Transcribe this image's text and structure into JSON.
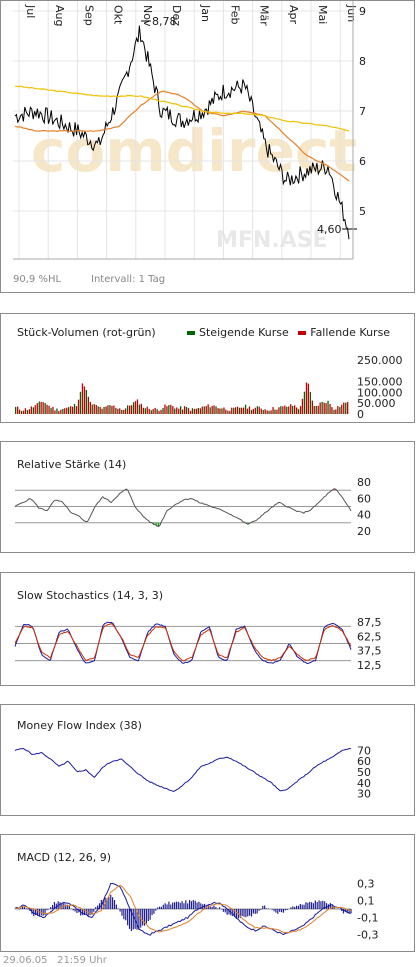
{
  "main": {
    "months": [
      "Jul",
      "Aug",
      "Sep",
      "Okt",
      "Nov",
      "Dez",
      "Jan",
      "Feb",
      "Mär",
      "Apr",
      "Mai",
      "Jun"
    ],
    "yticks": [
      "9",
      "8",
      "7",
      "6",
      "5"
    ],
    "high_label": "8,78",
    "last_label": "4,60",
    "watermark": "comdirect",
    "symbol": "MFN.ASE",
    "hl_label": "90,9 %HL",
    "interval_label": "Intervall: 1 Tag",
    "colors": {
      "price": "#000000",
      "ma38": "#e8802a",
      "ma200": "#f0c000"
    }
  },
  "volume": {
    "title": "Stück-Volumen (rot-grün)",
    "legend_up": "Steigende Kurse",
    "legend_down": "Fallende Kurse",
    "yticks": [
      "250.000",
      "150.000",
      "100.000",
      "50.000",
      "0"
    ],
    "colors": {
      "up": "#006400",
      "down": "#c00000"
    }
  },
  "rsi": {
    "title": "Relative Stärke (14)",
    "yticks": [
      "80",
      "60",
      "40",
      "20"
    ]
  },
  "stoch": {
    "title": "Slow Stochastics (14, 3, 3)",
    "yticks": [
      "87,5",
      "62,5",
      "37,5",
      "12,5"
    ]
  },
  "mfi": {
    "title": "Money Flow Index (38)",
    "yticks": [
      "70",
      "60",
      "50",
      "40",
      "30"
    ]
  },
  "macd": {
    "title": "MACD (12, 26, 9)",
    "yticks": [
      "0,3",
      "0,1",
      "-0,1",
      "-0,3"
    ]
  },
  "footer": {
    "date": "29.06.05",
    "time": "21:59 Uhr"
  },
  "chart_data": [
    {
      "type": "line",
      "title": "",
      "x": [
        "Jul",
        "Aug",
        "Sep",
        "Okt",
        "Nov",
        "Dez",
        "Jan",
        "Feb",
        "Mär",
        "Apr",
        "Mai",
        "Jun"
      ],
      "ylim": [
        4.4,
        9.0
      ],
      "series": [
        {
          "values": [
            6.9,
            7.0,
            6.8,
            6.6,
            6.3,
            7.3,
            8.6,
            7.0,
            6.8,
            7.0,
            7.4,
            7.5,
            6.3,
            5.6,
            5.8,
            5.9,
            4.6
          ]
        },
        {
          "values": [
            6.7,
            6.6,
            6.6,
            6.6,
            6.6,
            6.7,
            7.1,
            7.4,
            7.3,
            7.0,
            6.9,
            7.0,
            6.9,
            6.5,
            6.1,
            5.9,
            5.6
          ]
        },
        {
          "values": [
            7.5,
            7.45,
            7.4,
            7.35,
            7.3,
            7.3,
            7.3,
            7.2,
            7.1,
            7.0,
            6.95,
            6.95,
            6.9,
            6.8,
            6.75,
            6.7,
            6.6
          ]
        }
      ],
      "annotations": [
        "8,78",
        "4,60"
      ]
    },
    {
      "type": "bar",
      "ylim": [
        0,
        250000
      ],
      "series": [
        {
          "values": [
            30000,
            20000,
            25000,
            40000,
            60000,
            35000,
            20000,
            25000,
            30000,
            45000,
            150000,
            50000,
            35000,
            25000,
            40000,
            30000,
            20000,
            45000,
            60000,
            30000,
            25000,
            20000,
            35000,
            40000,
            25000,
            30000,
            20000,
            25000,
            35000,
            40000,
            30000,
            25000,
            20000,
            30000,
            35000,
            25000,
            30000,
            20000,
            25000,
            30000,
            35000,
            40000,
            25000,
            160000,
            30000,
            50000,
            60000,
            25000,
            40000,
            60000
          ]
        }
      ]
    },
    {
      "type": "line",
      "ylim": [
        10,
        85
      ],
      "series": [
        {
          "values": [
            50,
            55,
            60,
            48,
            45,
            58,
            55,
            42,
            38,
            30,
            50,
            62,
            55,
            65,
            72,
            50,
            38,
            30,
            25,
            45,
            52,
            58,
            60,
            55,
            52,
            48,
            45,
            40,
            35,
            28,
            32,
            40,
            48,
            55,
            50,
            45,
            42,
            46,
            55,
            65,
            72,
            60,
            45
          ]
        }
      ]
    },
    {
      "type": "line",
      "ylim": [
        0,
        100
      ],
      "series": [
        {
          "values": [
            45,
            85,
            80,
            30,
            20,
            70,
            75,
            40,
            15,
            20,
            85,
            88,
            60,
            25,
            20,
            70,
            85,
            80,
            30,
            15,
            20,
            70,
            80,
            25,
            20,
            75,
            80,
            40,
            20,
            15,
            20,
            50,
            25,
            15,
            20,
            80,
            85,
            75,
            40
          ]
        },
        {
          "values": [
            50,
            80,
            78,
            35,
            25,
            65,
            72,
            45,
            20,
            25,
            80,
            85,
            62,
            30,
            25,
            65,
            80,
            78,
            35,
            20,
            25,
            65,
            75,
            30,
            25,
            70,
            78,
            45,
            25,
            20,
            25,
            45,
            30,
            20,
            25,
            75,
            82,
            72,
            45
          ]
        }
      ]
    },
    {
      "type": "line",
      "ylim": [
        25,
        75
      ],
      "series": [
        {
          "values": [
            70,
            72,
            66,
            68,
            62,
            55,
            60,
            50,
            52,
            45,
            55,
            60,
            62,
            55,
            48,
            42,
            38,
            35,
            32,
            38,
            45,
            55,
            58,
            62,
            64,
            60,
            55,
            50,
            45,
            40,
            32,
            35,
            42,
            48,
            55,
            60,
            64,
            70,
            72
          ]
        }
      ]
    },
    {
      "type": "line",
      "ylim": [
        -0.35,
        0.35
      ],
      "series": [
        {
          "values": [
            0.0,
            0.05,
            -0.05,
            -0.1,
            0.0,
            0.08,
            0.05,
            -0.05,
            -0.1,
            0.05,
            0.3,
            0.25,
            0.0,
            -0.25,
            -0.3,
            -0.25,
            -0.2,
            -0.15,
            -0.1,
            0.0,
            0.05,
            0.08,
            0.02,
            -0.1,
            -0.2,
            -0.25,
            -0.2,
            -0.25,
            -0.3,
            -0.25,
            -0.2,
            -0.1,
            0.0,
            0.05,
            0.0,
            -0.05
          ]
        },
        {
          "values": [
            0.0,
            0.03,
            0.0,
            -0.06,
            -0.04,
            0.03,
            0.05,
            0.0,
            -0.06,
            -0.02,
            0.2,
            0.28,
            0.15,
            -0.1,
            -0.22,
            -0.27,
            -0.24,
            -0.2,
            -0.15,
            -0.06,
            0.02,
            0.06,
            0.05,
            -0.03,
            -0.14,
            -0.22,
            -0.22,
            -0.23,
            -0.27,
            -0.27,
            -0.23,
            -0.15,
            -0.06,
            0.02,
            0.02,
            -0.02
          ]
        }
      ]
    }
  ]
}
